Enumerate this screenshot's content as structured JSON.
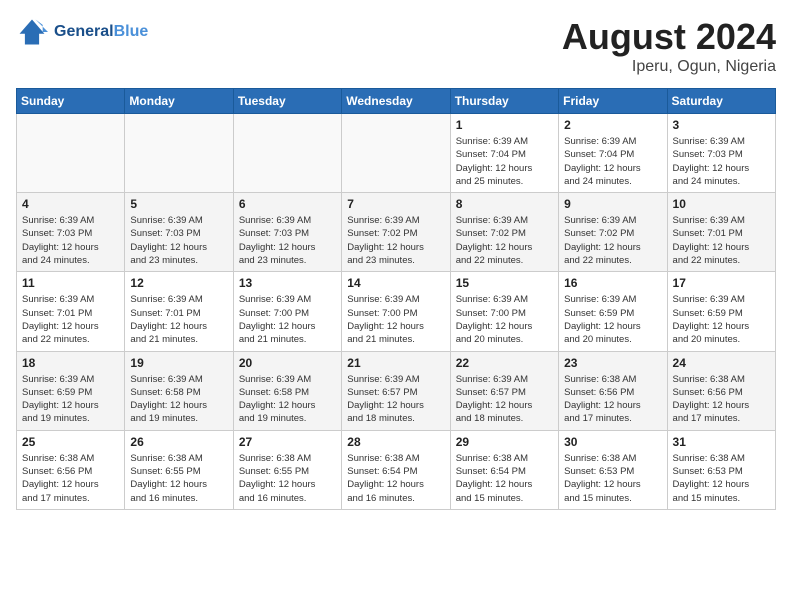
{
  "header": {
    "logo_line1": "General",
    "logo_line2": "Blue",
    "month": "August 2024",
    "location": "Iperu, Ogun, Nigeria"
  },
  "weekdays": [
    "Sunday",
    "Monday",
    "Tuesday",
    "Wednesday",
    "Thursday",
    "Friday",
    "Saturday"
  ],
  "weeks": [
    [
      {
        "day": "",
        "info": ""
      },
      {
        "day": "",
        "info": ""
      },
      {
        "day": "",
        "info": ""
      },
      {
        "day": "",
        "info": ""
      },
      {
        "day": "1",
        "info": "Sunrise: 6:39 AM\nSunset: 7:04 PM\nDaylight: 12 hours\nand 25 minutes."
      },
      {
        "day": "2",
        "info": "Sunrise: 6:39 AM\nSunset: 7:04 PM\nDaylight: 12 hours\nand 24 minutes."
      },
      {
        "day": "3",
        "info": "Sunrise: 6:39 AM\nSunset: 7:03 PM\nDaylight: 12 hours\nand 24 minutes."
      }
    ],
    [
      {
        "day": "4",
        "info": "Sunrise: 6:39 AM\nSunset: 7:03 PM\nDaylight: 12 hours\nand 24 minutes."
      },
      {
        "day": "5",
        "info": "Sunrise: 6:39 AM\nSunset: 7:03 PM\nDaylight: 12 hours\nand 23 minutes."
      },
      {
        "day": "6",
        "info": "Sunrise: 6:39 AM\nSunset: 7:03 PM\nDaylight: 12 hours\nand 23 minutes."
      },
      {
        "day": "7",
        "info": "Sunrise: 6:39 AM\nSunset: 7:02 PM\nDaylight: 12 hours\nand 23 minutes."
      },
      {
        "day": "8",
        "info": "Sunrise: 6:39 AM\nSunset: 7:02 PM\nDaylight: 12 hours\nand 22 minutes."
      },
      {
        "day": "9",
        "info": "Sunrise: 6:39 AM\nSunset: 7:02 PM\nDaylight: 12 hours\nand 22 minutes."
      },
      {
        "day": "10",
        "info": "Sunrise: 6:39 AM\nSunset: 7:01 PM\nDaylight: 12 hours\nand 22 minutes."
      }
    ],
    [
      {
        "day": "11",
        "info": "Sunrise: 6:39 AM\nSunset: 7:01 PM\nDaylight: 12 hours\nand 22 minutes."
      },
      {
        "day": "12",
        "info": "Sunrise: 6:39 AM\nSunset: 7:01 PM\nDaylight: 12 hours\nand 21 minutes."
      },
      {
        "day": "13",
        "info": "Sunrise: 6:39 AM\nSunset: 7:00 PM\nDaylight: 12 hours\nand 21 minutes."
      },
      {
        "day": "14",
        "info": "Sunrise: 6:39 AM\nSunset: 7:00 PM\nDaylight: 12 hours\nand 21 minutes."
      },
      {
        "day": "15",
        "info": "Sunrise: 6:39 AM\nSunset: 7:00 PM\nDaylight: 12 hours\nand 20 minutes."
      },
      {
        "day": "16",
        "info": "Sunrise: 6:39 AM\nSunset: 6:59 PM\nDaylight: 12 hours\nand 20 minutes."
      },
      {
        "day": "17",
        "info": "Sunrise: 6:39 AM\nSunset: 6:59 PM\nDaylight: 12 hours\nand 20 minutes."
      }
    ],
    [
      {
        "day": "18",
        "info": "Sunrise: 6:39 AM\nSunset: 6:59 PM\nDaylight: 12 hours\nand 19 minutes."
      },
      {
        "day": "19",
        "info": "Sunrise: 6:39 AM\nSunset: 6:58 PM\nDaylight: 12 hours\nand 19 minutes."
      },
      {
        "day": "20",
        "info": "Sunrise: 6:39 AM\nSunset: 6:58 PM\nDaylight: 12 hours\nand 19 minutes."
      },
      {
        "day": "21",
        "info": "Sunrise: 6:39 AM\nSunset: 6:57 PM\nDaylight: 12 hours\nand 18 minutes."
      },
      {
        "day": "22",
        "info": "Sunrise: 6:39 AM\nSunset: 6:57 PM\nDaylight: 12 hours\nand 18 minutes."
      },
      {
        "day": "23",
        "info": "Sunrise: 6:38 AM\nSunset: 6:56 PM\nDaylight: 12 hours\nand 17 minutes."
      },
      {
        "day": "24",
        "info": "Sunrise: 6:38 AM\nSunset: 6:56 PM\nDaylight: 12 hours\nand 17 minutes."
      }
    ],
    [
      {
        "day": "25",
        "info": "Sunrise: 6:38 AM\nSunset: 6:56 PM\nDaylight: 12 hours\nand 17 minutes."
      },
      {
        "day": "26",
        "info": "Sunrise: 6:38 AM\nSunset: 6:55 PM\nDaylight: 12 hours\nand 16 minutes."
      },
      {
        "day": "27",
        "info": "Sunrise: 6:38 AM\nSunset: 6:55 PM\nDaylight: 12 hours\nand 16 minutes."
      },
      {
        "day": "28",
        "info": "Sunrise: 6:38 AM\nSunset: 6:54 PM\nDaylight: 12 hours\nand 16 minutes."
      },
      {
        "day": "29",
        "info": "Sunrise: 6:38 AM\nSunset: 6:54 PM\nDaylight: 12 hours\nand 15 minutes."
      },
      {
        "day": "30",
        "info": "Sunrise: 6:38 AM\nSunset: 6:53 PM\nDaylight: 12 hours\nand 15 minutes."
      },
      {
        "day": "31",
        "info": "Sunrise: 6:38 AM\nSunset: 6:53 PM\nDaylight: 12 hours\nand 15 minutes."
      }
    ]
  ]
}
